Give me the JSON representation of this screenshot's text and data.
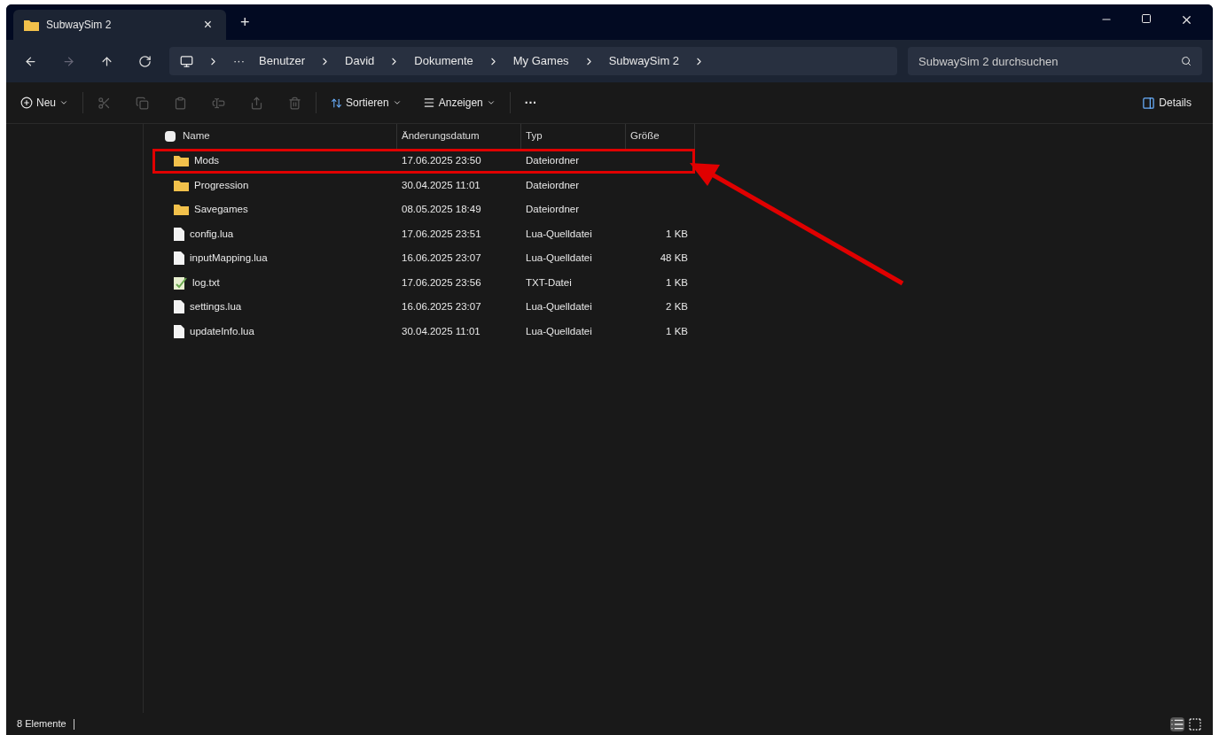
{
  "tab": {
    "title": "SubwaySim 2",
    "close": "×"
  },
  "new_tab": "+",
  "nav": [
    {
      "kind": "back",
      "disabled": false
    },
    {
      "kind": "forward",
      "disabled": true
    },
    {
      "kind": "up",
      "disabled": false
    },
    {
      "kind": "refresh",
      "disabled": false
    }
  ],
  "breadcrumb": {
    "overflow": "···",
    "items": [
      "Benutzer",
      "David",
      "Dokumente",
      "My Games",
      "SubwaySim 2"
    ]
  },
  "search": {
    "placeholder": "SubwaySim 2 durchsuchen"
  },
  "toolbar": {
    "new": "Neu",
    "actions": [
      {
        "kind": "cut",
        "disabled": true
      },
      {
        "kind": "copy",
        "disabled": true
      },
      {
        "kind": "paste",
        "disabled": true
      },
      {
        "kind": "rename",
        "disabled": true
      },
      {
        "kind": "share",
        "disabled": true
      },
      {
        "kind": "delete",
        "disabled": true
      }
    ],
    "sort": "Sortieren",
    "view": "Anzeigen",
    "more": "···",
    "details": "Details"
  },
  "table": {
    "select_all": {
      "checked": false
    },
    "columns": [
      "Name",
      "Änderungsdatum",
      "Typ",
      "Größe"
    ],
    "rows": [
      {
        "kind": "folder",
        "name": "Mods",
        "date": "17.06.2025 23:50",
        "type": "Dateiordner",
        "highlighted": true
      },
      {
        "kind": "folder",
        "name": "Progression",
        "date": "30.04.2025 11:01",
        "type": "Dateiordner",
        "highlighted": false
      },
      {
        "kind": "folder",
        "name": "Savegames",
        "date": "08.05.2025 18:49",
        "type": "Dateiordner",
        "highlighted": false
      },
      {
        "kind": "file",
        "name": "config.lua",
        "date": "17.06.2025 23:51",
        "type": "Lua-Quelldatei",
        "size": "1 KB",
        "highlighted": false
      },
      {
        "kind": "file",
        "name": "inputMapping.lua",
        "date": "16.06.2025 23:07",
        "type": "Lua-Quelldatei",
        "size": "48 KB",
        "highlighted": false
      },
      {
        "kind": "text",
        "name": "log.txt",
        "date": "17.06.2025 23:56",
        "type": "TXT-Datei",
        "size": "1 KB",
        "highlighted": false
      },
      {
        "kind": "file",
        "name": "settings.lua",
        "date": "16.06.2025 23:07",
        "type": "Lua-Quelldatei",
        "size": "2 KB",
        "highlighted": false
      },
      {
        "kind": "file",
        "name": "updateInfo.lua",
        "date": "30.04.2025 11:01",
        "type": "Lua-Quelldatei",
        "size": "1 KB",
        "highlighted": false
      }
    ]
  },
  "status_bar": {
    "count": "8 Elemente"
  }
}
